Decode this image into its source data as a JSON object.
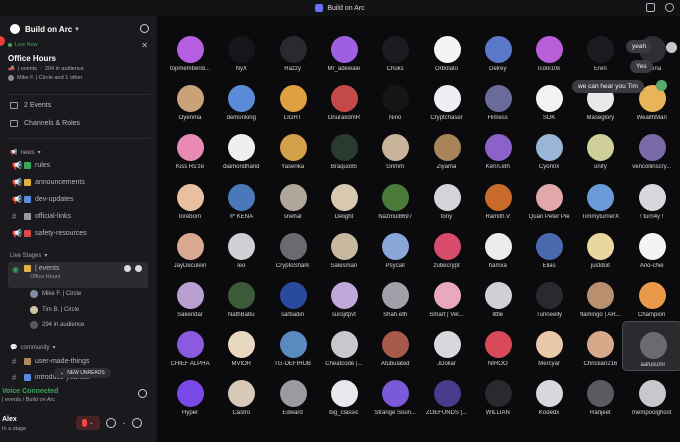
{
  "window": {
    "title": "Build on Arc"
  },
  "server": {
    "name": "Build on Arc"
  },
  "live": {
    "label": "Live Now",
    "title": "Office Hours",
    "meta_channel": "| events",
    "audience": "294 in audience",
    "speakers": "Mike F. | Circle and 1 other"
  },
  "nav": {
    "events": "2 Events",
    "channels_roles": "Channels & Roles"
  },
  "categories": {
    "news": "news",
    "live_stages": "Live Stages",
    "community": "community"
  },
  "news_channels": [
    {
      "name": "rules"
    },
    {
      "name": "announcements"
    },
    {
      "name": "dev-updates"
    },
    {
      "name": "official-links"
    },
    {
      "name": "safety-resources"
    }
  ],
  "stage_channel": {
    "name": "| events",
    "sub": "Office Hours"
  },
  "voice_users": [
    {
      "name": "Mike F. | Circle",
      "color": "#7e8ea8"
    },
    {
      "name": "Tim B. | Circle",
      "color": "#d0c4a8"
    },
    {
      "name": "294 in audience",
      "color": "#555a62"
    }
  ],
  "community_channels": [
    {
      "name": "user-made-things"
    },
    {
      "name": "introduce-yourself"
    }
  ],
  "new_unreads": "NEW UNREADS",
  "voice": {
    "title": "Voice Connected",
    "sub": "| events / Build on Arc"
  },
  "user": {
    "name": "Alex",
    "status": "In a stage"
  },
  "chat_bubbles": [
    {
      "text": "yeah"
    },
    {
      "text": "Yes"
    },
    {
      "text": "we can hear you Tim"
    }
  ],
  "audience": [
    [
      "topmemberdi...",
      "NyX",
      "Razzy",
      "Mr_adewale",
      "Chuks",
      "Orbolato",
      "Delrey",
      "Iconi10k",
      "Eren",
      "Verena"
    ],
    [
      "Oyenma",
      "demonking",
      "LIGHT",
      "OnurakdmR",
      "Nino",
      "Cryptchaser",
      "Himess",
      "SDK",
      "Maseglory",
      "WealthMan"
    ],
    [
      "Kiss Ru'ze",
      "diamondhand",
      "Yasenka",
      "Braquo85",
      "Grimm",
      "Ziyama",
      "Kenn.eth",
      "Cyon0x",
      "unify",
      "vencollinscry..."
    ],
    [
      "toreborn",
      "!I* KENA",
      "snehal",
      "Delight",
      "Nazmul8697",
      "tony",
      "Ramith.V",
      "Quan Peter Pie",
      "TimmyturnerX",
      "! turn4y !"
    ],
    [
      "JayDeculein",
      "leo",
      "CryptoShark",
      "Salesman",
      "Psycall",
      "zubecrypt",
      "hamxa",
      "Elias",
      "justdoit",
      "Ano-chie"
    ],
    [
      "Sakendar",
      "NathBabu",
      "sarbadin",
      "surojitpvt",
      "Shah.eth",
      "Smart | Vel...",
      "little",
      "Tunneelly",
      "flamingo | AR...",
      "Champion"
    ],
    [
      "CHIEF ALPHA",
      "MVIOR",
      "TG-DEFIHUB",
      "Cheatcode |...",
      "Atubulated",
      "JDollar",
      "NIROO",
      "Mercyar",
      "Christian216",
      "aafusumi"
    ],
    [
      "Hyper",
      "Castro",
      "Edward",
      "big_classic",
      "Strange Soun...",
      "ZOEFUNDS |...",
      "WILLIAN",
      "Kodedx",
      "Ranjeet",
      "mempoolghost"
    ]
  ],
  "avatar_colors": [
    [
      "#b55fe0",
      "#16161a",
      "#2a2a2e",
      "#9f5fe0",
      "#1c1c20",
      "#f4f4f6",
      "#5a78c8",
      "#b85fd8",
      "#1b1b1f",
      "#2e2e35"
    ],
    [
      "#c9a27a",
      "#5b8bd6",
      "#e0a040",
      "#c44a4a",
      "#151518",
      "#eceef2",
      "#6b6b9a",
      "#f2f2f2",
      "#e8e8ea",
      "#e8b45a"
    ],
    [
      "#e88ab4",
      "#efefef",
      "#d2a24a",
      "#2a3a30",
      "#c8b49a",
      "#a7845a",
      "#8a62c8",
      "#9ab6d6",
      "#cfcf9a",
      "#7a6aa8"
    ],
    [
      "#e8c0a0",
      "#4a78b8",
      "#b0a69a",
      "#d8c8b0",
      "#4a7a3a",
      "#d4d4d8",
      "#c86a2a",
      "#e0a8a8",
      "#6a9ad8",
      "#d8d8dc"
    ],
    [
      "#d8a890",
      "#d0d0d4",
      "#6a6a70",
      "#c8b8a0",
      "#8aa6d8",
      "#d84a6a",
      "#ececee",
      "#4a6ab0",
      "#e8d8a0",
      "#f4f4f4"
    ],
    [
      "#b8a0d0",
      "#3a5a3a",
      "#2a4aa0",
      "#c0a8d8",
      "#a0a0a8",
      "#e8a8c0",
      "#d0d0d8",
      "#2a2a2e",
      "#b89070",
      "#e89a4a"
    ],
    [
      "#8a5ae0",
      "#e8d8c0",
      "#5a8ac0",
      "#c8c8cc",
      "#a85a4a",
      "#d8d8dc",
      "#d84a5a",
      "#e8c8a8",
      "#d8a88a",
      "#6a6a70"
    ],
    [
      "#7a4ae8",
      "#d8c8b8",
      "#9a9aa0",
      "#e8e8ec",
      "#7a5ad8",
      "#4a3a8a",
      "#2a2a2e",
      "#d8d8dc",
      "#5a5a60",
      "#c8c8cc"
    ]
  ]
}
